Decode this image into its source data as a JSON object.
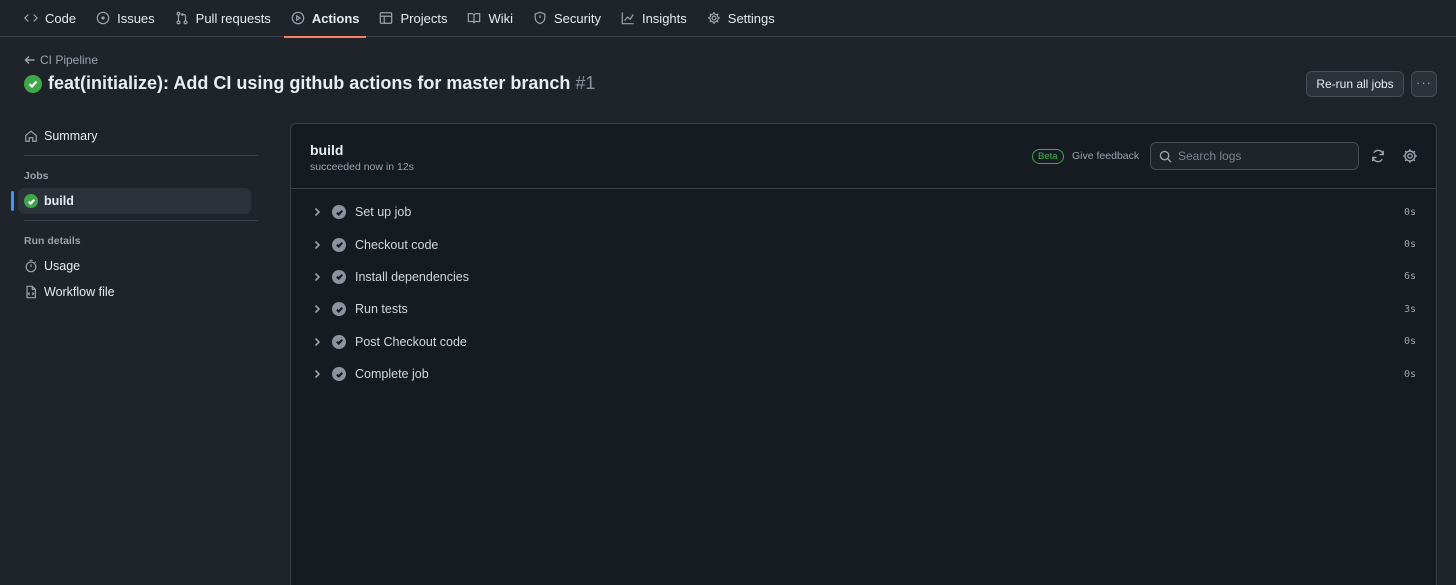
{
  "nav": {
    "items": [
      {
        "label": "Code",
        "icon": "code-icon"
      },
      {
        "label": "Issues",
        "icon": "issue-icon"
      },
      {
        "label": "Pull requests",
        "icon": "pull-request-icon"
      },
      {
        "label": "Actions",
        "icon": "play-icon",
        "active": true
      },
      {
        "label": "Projects",
        "icon": "table-icon"
      },
      {
        "label": "Wiki",
        "icon": "book-icon"
      },
      {
        "label": "Security",
        "icon": "shield-icon"
      },
      {
        "label": "Insights",
        "icon": "graph-icon"
      },
      {
        "label": "Settings",
        "icon": "gear-icon"
      }
    ]
  },
  "header": {
    "back_label": "CI Pipeline",
    "run_title": "feat(initialize): Add CI using github actions for master branch",
    "run_number": "#1",
    "rerun_label": "Re-run all jobs"
  },
  "sidebar": {
    "summary_label": "Summary",
    "jobs_heading": "Jobs",
    "job_label": "build",
    "run_details_heading": "Run details",
    "usage_label": "Usage",
    "workflow_file_label": "Workflow file"
  },
  "job": {
    "title": "build",
    "status": "succeeded now in 12s",
    "beta_label": "Beta",
    "feedback_label": "Give feedback",
    "search_placeholder": "Search logs",
    "steps": [
      {
        "name": "Set up job",
        "duration": "0s"
      },
      {
        "name": "Checkout code",
        "duration": "0s"
      },
      {
        "name": "Install dependencies",
        "duration": "6s"
      },
      {
        "name": "Run tests",
        "duration": "3s"
      },
      {
        "name": "Post Checkout code",
        "duration": "0s"
      },
      {
        "name": "Complete job",
        "duration": "0s"
      }
    ]
  },
  "colors": {
    "accent_tab": "#f78166",
    "success": "#3fa64a",
    "selected_marker": "#4493f8"
  }
}
